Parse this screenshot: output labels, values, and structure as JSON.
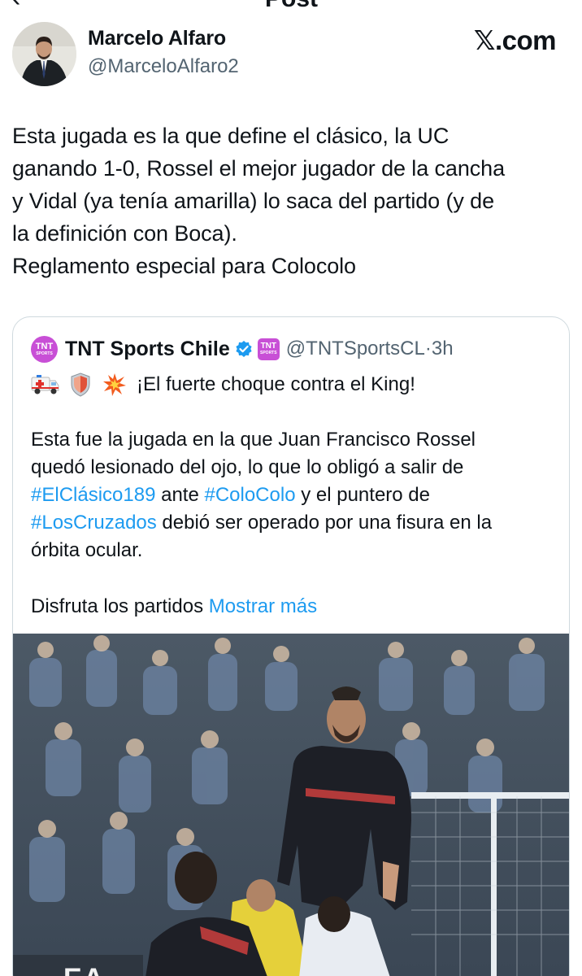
{
  "header": {
    "back_glyph": "‹",
    "title": "Post"
  },
  "author": {
    "name": "Marcelo Alfaro",
    "handle": "@MarceloAlfaro2"
  },
  "watermark": "𝕏.com",
  "tweet": {
    "lines": [
      "Esta jugada es la que define el clásico, la UC",
      "ganando 1-0, Rossel el mejor jugador de la cancha",
      "y Vidal (ya tenía  amarilla) lo saca del partido (y de",
      "la definición con Boca).",
      "Reglamento especial para Colocolo"
    ]
  },
  "quote": {
    "logo_text": "TNT",
    "logo_sub": "SPORTS",
    "name": "TNT Sports Chile",
    "handle": "@TNTSportsCL",
    "sep": "·",
    "time": "3h",
    "emoji_icons": [
      "ambulance-icon",
      "shield-icon",
      "collision-icon"
    ],
    "headline": "¡El fuerte choque contra el King!",
    "body": {
      "line1": "Esta fue la jugada en la que Juan Francisco Rossel",
      "line2": "quedó lesionado del ojo, lo que lo obligó a salir de",
      "tag1": "#ElClásico189",
      "line3_mid": " ante ",
      "tag2": "#ColoColo",
      "line3_end": " y el puntero de",
      "tag3": "#LosCruzados",
      "line4_end": " debió ser operado por una fisura en la",
      "line5": "órbita ocular."
    },
    "more_text": "Disfruta los partidos",
    "more_link": "Mostrar más",
    "media_overlay": "EA"
  },
  "colors": {
    "link": "#1d9bf0",
    "brand_purple": "#c84fd6",
    "muted": "#536471"
  }
}
